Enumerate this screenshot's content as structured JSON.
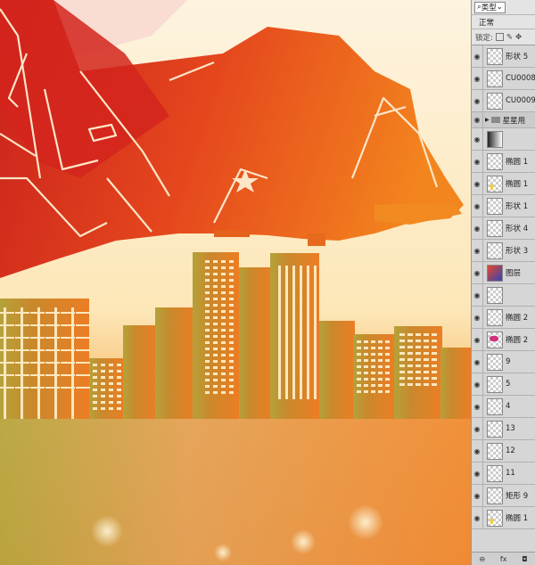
{
  "layers_panel": {
    "filter_label": "类型",
    "blend_mode": "正常",
    "lock_label": "锁定:",
    "items": [
      {
        "name": "形状 5",
        "kind": "layer",
        "thumb": "checker"
      },
      {
        "name": "CU0008",
        "kind": "layer",
        "thumb": "checker"
      },
      {
        "name": "CU0009",
        "kind": "layer",
        "thumb": "checker"
      },
      {
        "name": "星星用",
        "kind": "group",
        "thumb": "folder"
      },
      {
        "name": "",
        "kind": "layer",
        "thumb": "mask"
      },
      {
        "name": "椭圆 1",
        "kind": "layer",
        "thumb": "checker"
      },
      {
        "name": "椭圆 1",
        "kind": "layer",
        "thumb": "yellow"
      },
      {
        "name": "形状 1",
        "kind": "layer",
        "thumb": "checker"
      },
      {
        "name": "形状 4",
        "kind": "layer",
        "thumb": "checker"
      },
      {
        "name": "形状 3",
        "kind": "layer",
        "thumb": "checker"
      },
      {
        "name": "图层",
        "kind": "layer",
        "thumb": "fx"
      },
      {
        "name": "",
        "kind": "layer",
        "thumb": "checker"
      },
      {
        "name": "椭圆 2",
        "kind": "layer",
        "thumb": "checker"
      },
      {
        "name": "椭圆 2",
        "kind": "layer",
        "thumb": "pink"
      },
      {
        "name": "9",
        "kind": "layer",
        "thumb": "checker"
      },
      {
        "name": "5",
        "kind": "layer",
        "thumb": "checker"
      },
      {
        "name": "4",
        "kind": "layer",
        "thumb": "checker"
      },
      {
        "name": "13",
        "kind": "layer",
        "thumb": "checker"
      },
      {
        "name": "12",
        "kind": "layer",
        "thumb": "checker"
      },
      {
        "name": "11",
        "kind": "layer",
        "thumb": "checker"
      },
      {
        "name": "矩形 9",
        "kind": "layer",
        "thumb": "checker"
      },
      {
        "name": "椭圆 1",
        "kind": "layer",
        "thumb": "yellow"
      }
    ],
    "footer": {
      "link": "⊖",
      "fx": "fx"
    }
  },
  "colors": {
    "sky_top": "#fdf0d8",
    "plane_red": "#d9301f",
    "plane_orange": "#f07a1f",
    "city_orange": "#e07a25",
    "city_olive": "#b2a139",
    "window_cream": "#fbe7bd"
  }
}
